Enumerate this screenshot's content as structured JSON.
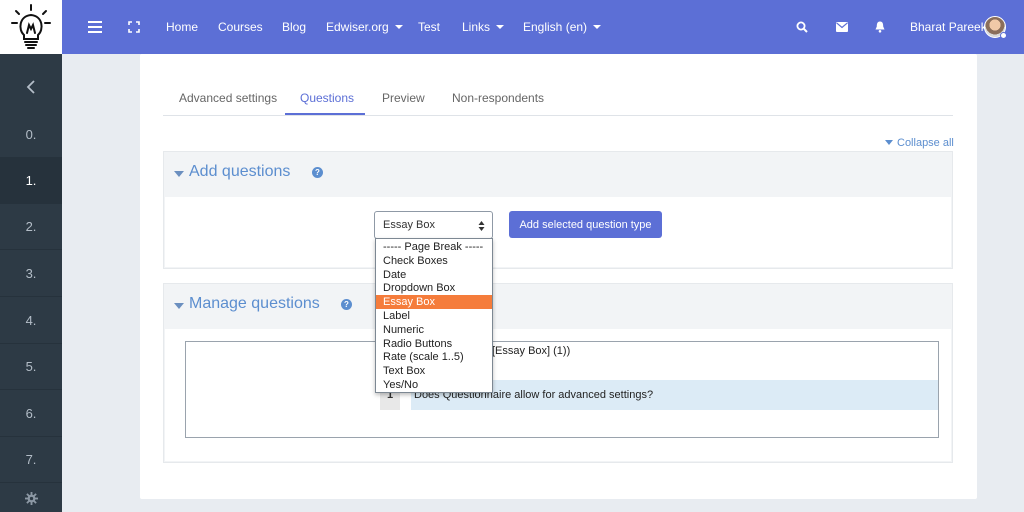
{
  "nav": {
    "links": [
      {
        "label": "Home"
      },
      {
        "label": "Courses"
      },
      {
        "label": "Blog"
      },
      {
        "label": "Edwiser.org",
        "dropdown": true
      },
      {
        "label": "Test"
      },
      {
        "label": "Links",
        "dropdown": true
      },
      {
        "label": "English (en)",
        "dropdown": true
      }
    ],
    "user_name": "Bharat Pareek",
    "icons": [
      "menu-icon",
      "fullscreen-icon",
      "search-icon",
      "mail-icon",
      "bell-icon"
    ]
  },
  "rail": {
    "items": [
      "0.",
      "1.",
      "2.",
      "3.",
      "4.",
      "5.",
      "6.",
      "7."
    ],
    "active_index": 1,
    "icons": [
      "chevron-left-icon",
      "gear-icon"
    ]
  },
  "tabs": [
    "Advanced settings",
    "Questions",
    "Preview",
    "Non-respondents"
  ],
  "active_tab": "Questions",
  "collapse_all": "Collapse all",
  "add_section": {
    "title": "Add questions",
    "help": "?",
    "select_value": "Essay Box",
    "button": "Add selected question type"
  },
  "dropdown_options": [
    "----- Page Break -----",
    "Check Boxes",
    "Date",
    "Dropdown Box",
    "Essay Box",
    "Label",
    "Numeric",
    "Radio Buttons",
    "Rate (scale 1..5)",
    "Text Box",
    "Yes/No"
  ],
  "selected_option": "Essay Box",
  "manage_section": {
    "title": "Manage questions",
    "help": "?",
    "question_type": "[Essay Box]   (1))",
    "question_number": "1",
    "question_text": "Does Questionnaire allow for advanced settings?"
  },
  "colors": {
    "navbar": "#5c6fd6",
    "rail": "#2d3a45",
    "accent": "#5c8ecf",
    "selected_option": "#f57c3b"
  }
}
